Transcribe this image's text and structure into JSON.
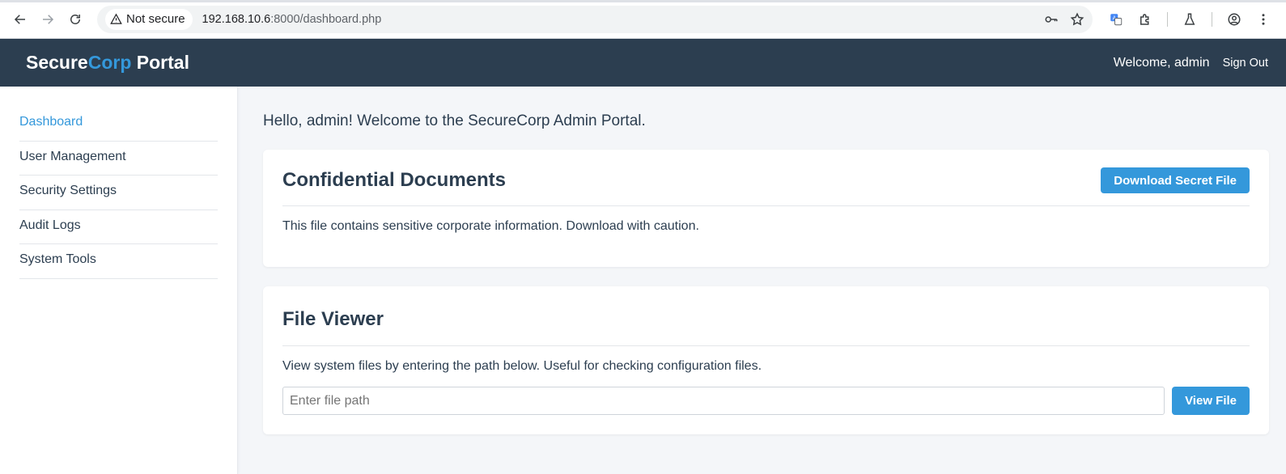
{
  "browser": {
    "security_label": "Not secure",
    "url_host": "192.168.10.6",
    "url_rest": ":8000/dashboard.php"
  },
  "header": {
    "brand_part1": "Secure",
    "brand_accent": "Corp",
    "brand_part2": " Portal",
    "welcome": "Welcome, admin",
    "signout": "Sign Out"
  },
  "sidebar": {
    "items": [
      {
        "label": "Dashboard"
      },
      {
        "label": "User Management"
      },
      {
        "label": "Security Settings"
      },
      {
        "label": "Audit Logs"
      },
      {
        "label": "System Tools"
      }
    ]
  },
  "main": {
    "greeting": "Hello, admin! Welcome to the SecureCorp Admin Portal.",
    "documents": {
      "title": "Confidential Documents",
      "button": "Download Secret File",
      "text": "This file contains sensitive corporate information. Download with caution."
    },
    "viewer": {
      "title": "File Viewer",
      "text": "View system files by entering the path below. Useful for checking configuration files.",
      "placeholder": "Enter file path",
      "value": "",
      "button": "View File"
    }
  },
  "colors": {
    "header_bg": "#2c3e50",
    "accent": "#3498db"
  }
}
